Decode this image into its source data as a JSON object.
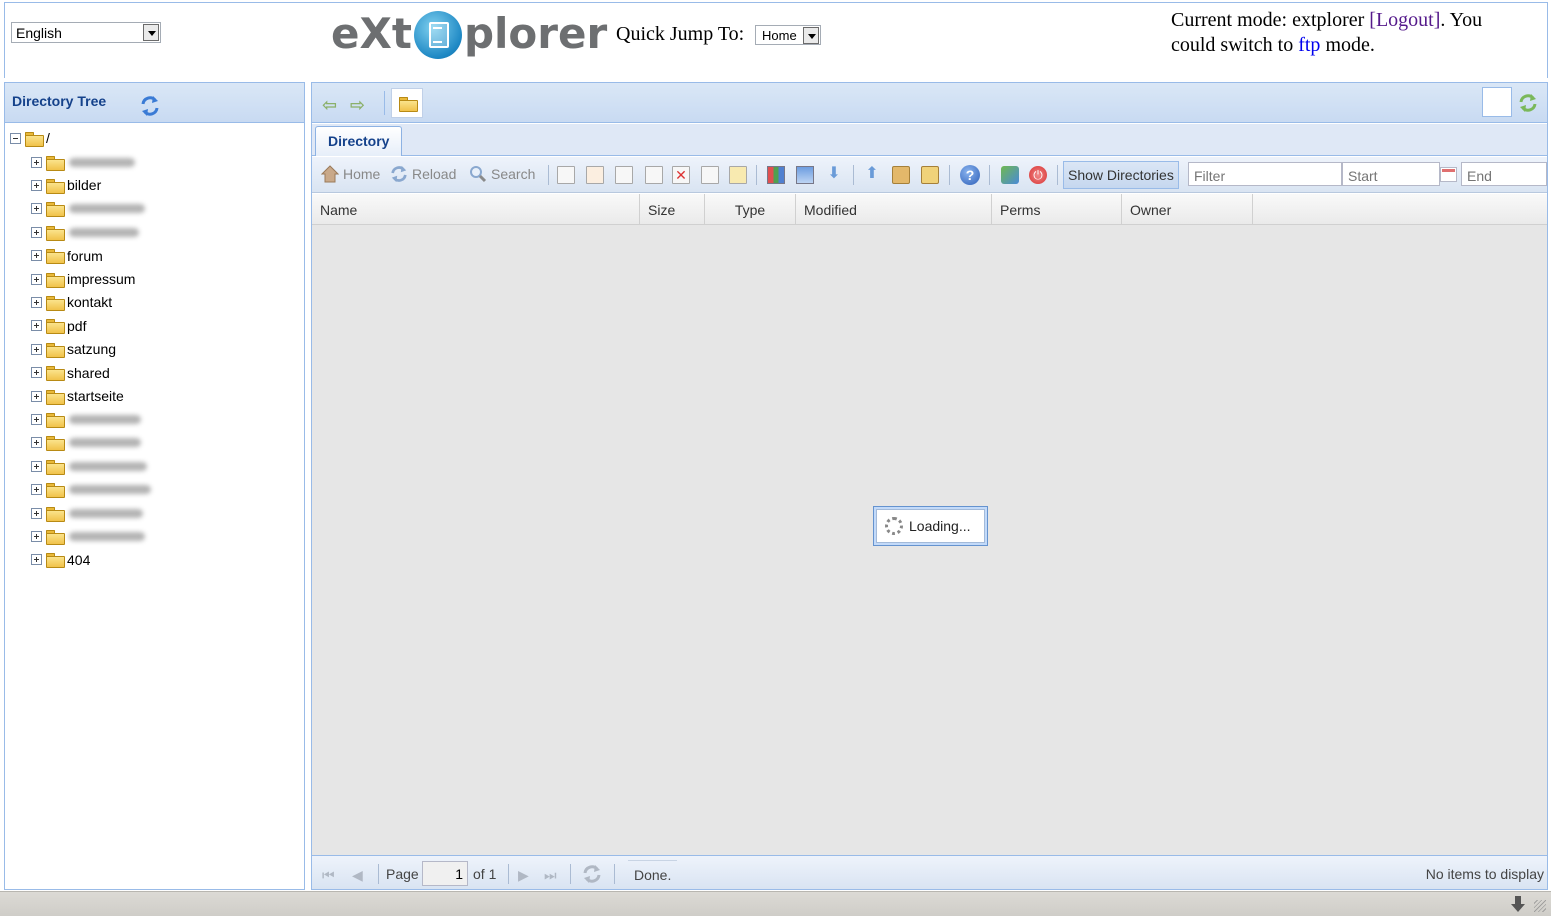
{
  "header": {
    "language": "English",
    "logo_prefix": "eXt",
    "logo_suffix": "plorer",
    "quick_jump_label": "Quick Jump To:",
    "quick_jump_value": "Home",
    "mode_prefix": "Current mode: extplorer",
    "mode_logout": "[Logout]",
    "mode_middle": ". You could switch to",
    "mode_ftp": "ftp",
    "mode_suffix": "mode."
  },
  "tree": {
    "title": "Directory Tree",
    "root": "/",
    "items": [
      {
        "label": "",
        "blurred": true
      },
      {
        "label": "bilder",
        "blurred": false
      },
      {
        "label": "",
        "blurred": true
      },
      {
        "label": "",
        "blurred": true
      },
      {
        "label": "forum",
        "blurred": false
      },
      {
        "label": "impressum",
        "blurred": false
      },
      {
        "label": "kontakt",
        "blurred": false
      },
      {
        "label": "pdf",
        "blurred": false
      },
      {
        "label": "satzung",
        "blurred": false
      },
      {
        "label": "shared",
        "blurred": false
      },
      {
        "label": "startseite",
        "blurred": false
      },
      {
        "label": "",
        "blurred": true
      },
      {
        "label": "",
        "blurred": true
      },
      {
        "label": "",
        "blurred": true
      },
      {
        "label": "",
        "blurred": true
      },
      {
        "label": "",
        "blurred": true
      },
      {
        "label": "",
        "blurred": true
      },
      {
        "label": "404",
        "blurred": false
      }
    ]
  },
  "tabs": [
    {
      "label": "Directory"
    }
  ],
  "toolbar": {
    "home": "Home",
    "reload": "Reload",
    "search": "Search",
    "show_directories": "Show Directories",
    "filter_placeholder": "Filter",
    "start_placeholder": "Start",
    "end_placeholder": "End"
  },
  "grid": {
    "columns": [
      "Name",
      "Size",
      "Type",
      "Modified",
      "Perms",
      "Owner"
    ],
    "loading": "Loading..."
  },
  "pager": {
    "page_label": "Page",
    "page_value": "1",
    "of_label": "of 1",
    "status": "Done.",
    "empty": "No items to display"
  },
  "colors": {
    "panel_border": "#99bbe8",
    "header_text": "#15428b",
    "visited_link": "#551a8b",
    "link": "#0000ee"
  }
}
